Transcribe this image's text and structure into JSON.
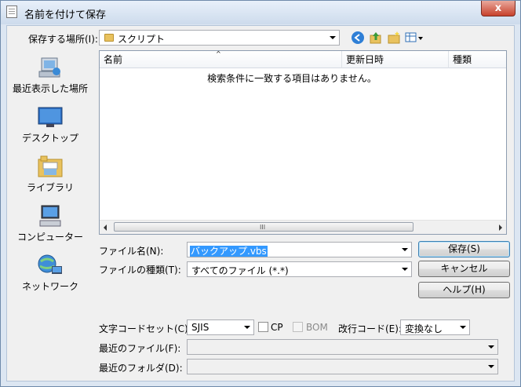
{
  "window": {
    "title": "名前を付けて保存",
    "close_label": "x"
  },
  "location": {
    "label": "保存する場所(I):",
    "value": "スクリプト"
  },
  "toolbar": {
    "back_icon": "back-arrow-icon",
    "up_icon": "up-folder-icon",
    "new_folder_icon": "new-folder-icon",
    "view_icon": "view-menu-icon"
  },
  "places": [
    {
      "label": "最近表示した場所",
      "icon": "recent-places-icon"
    },
    {
      "label": "デスクトップ",
      "icon": "desktop-icon"
    },
    {
      "label": "ライブラリ",
      "icon": "libraries-icon"
    },
    {
      "label": "コンピューター",
      "icon": "computer-icon"
    },
    {
      "label": "ネットワーク",
      "icon": "network-icon"
    }
  ],
  "file_list": {
    "columns": [
      "名前",
      "更新日時",
      "種類"
    ],
    "empty_message": "検索条件に一致する項目はありません。",
    "scroll_grip": "III"
  },
  "filename": {
    "label": "ファイル名(N):",
    "value": "バックアップ.vbs"
  },
  "filetype": {
    "label": "ファイルの種類(T):",
    "value": "すべてのファイル (*.*)"
  },
  "buttons": {
    "save": "保存(S)",
    "cancel": "キャンセル",
    "help": "ヘルプ(H)"
  },
  "encoding": {
    "label": "文字コードセット(C):",
    "value": "SJIS",
    "cp_label": "CP",
    "cp_checked": false,
    "bom_label": "BOM",
    "bom_checked": false,
    "newline_label": "改行コード(E):",
    "newline_value": "変換なし"
  },
  "recent_files": {
    "label": "最近のファイル(F):",
    "value": ""
  },
  "recent_folders": {
    "label": "最近のフォルダ(D):",
    "value": ""
  },
  "colors": {
    "accent": "#3399ff",
    "close": "#c7412c",
    "frame": "#dce6f2"
  }
}
